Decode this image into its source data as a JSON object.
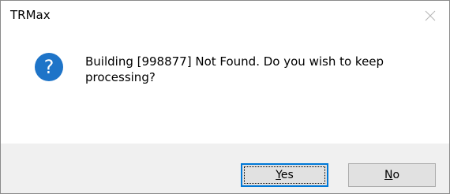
{
  "window": {
    "title": "TRMax"
  },
  "message": {
    "text": "Building [998877] Not Found.  Do you wish to keep processing?",
    "icon": "question-icon"
  },
  "buttons": {
    "yes": {
      "mnemonic": "Y",
      "rest": "es"
    },
    "no": {
      "mnemonic": "N",
      "rest": "o"
    }
  },
  "colors": {
    "icon_blue": "#1e74c8",
    "default_border": "#0078d7",
    "footer_bg": "#f0f0f0",
    "button_bg": "#e1e1e1"
  }
}
